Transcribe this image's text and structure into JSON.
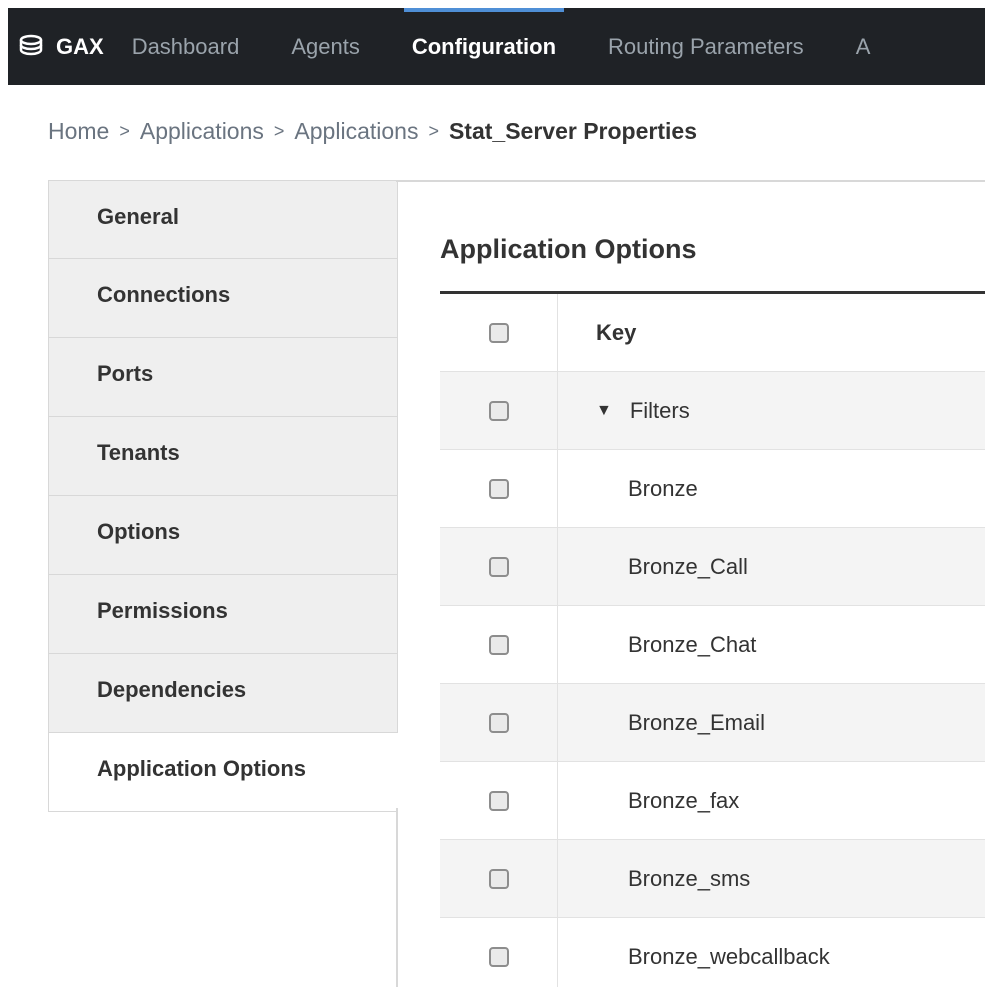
{
  "topnav": {
    "brand": "GAX",
    "items": [
      {
        "label": "Dashboard",
        "active": false
      },
      {
        "label": "Agents",
        "active": false
      },
      {
        "label": "Configuration",
        "active": true
      },
      {
        "label": "Routing Parameters",
        "active": false
      },
      {
        "label": "A",
        "active": false
      }
    ]
  },
  "breadcrumb": {
    "items": [
      "Home",
      "Applications",
      "Applications"
    ],
    "separator": ">",
    "current": "Stat_Server Properties"
  },
  "sidebar": {
    "items": [
      {
        "label": "General"
      },
      {
        "label": "Connections"
      },
      {
        "label": "Ports"
      },
      {
        "label": "Tenants"
      },
      {
        "label": "Options"
      },
      {
        "label": "Permissions"
      },
      {
        "label": "Dependencies"
      },
      {
        "label": "Application Options",
        "active": true
      }
    ]
  },
  "main": {
    "title": "Application Options",
    "table": {
      "header": "Key",
      "group": {
        "label": "Filters",
        "expanded": true
      },
      "rows": [
        "Bronze",
        "Bronze_Call",
        "Bronze_Chat",
        "Bronze_Email",
        "Bronze_fax",
        "Bronze_sms",
        "Bronze_webcallback"
      ]
    }
  },
  "colors": {
    "topbar": "#1f2226",
    "active_accent": "#4f8fd6",
    "sidebar_bg": "#efefef",
    "row_alt": "#f4f4f4"
  }
}
